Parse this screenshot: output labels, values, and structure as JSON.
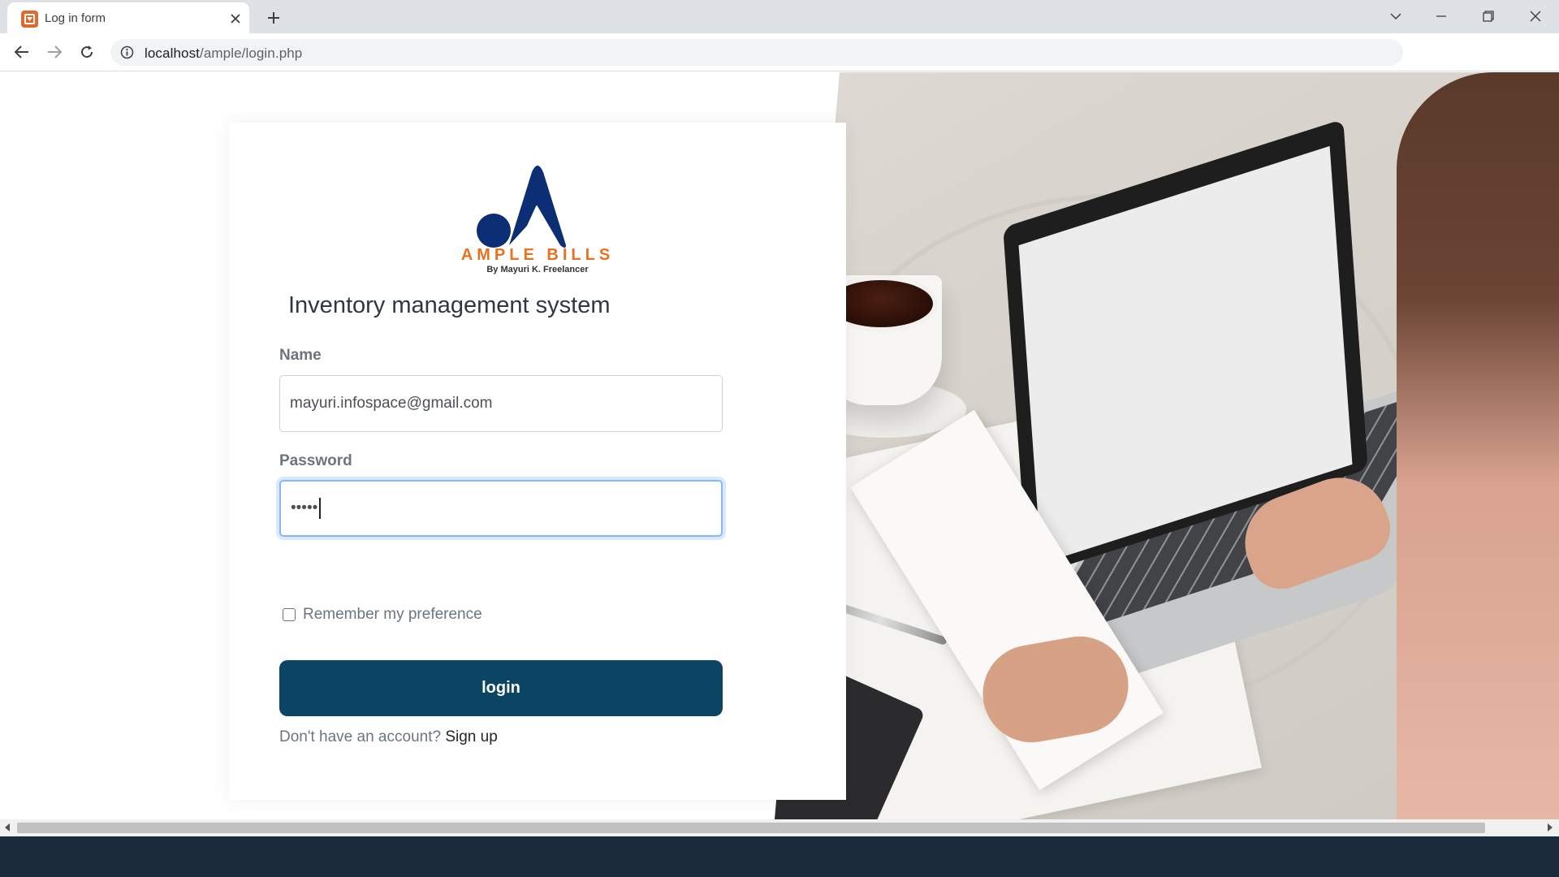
{
  "browser": {
    "tab_title": "Log in form",
    "url_host": "localhost",
    "url_path": "/ample/login.php"
  },
  "logo": {
    "name": "AMPLE BILLS",
    "tagline": "By Mayuri K. Freelancer",
    "mark_color": "#0b2e74",
    "name_color": "#e8731e"
  },
  "form": {
    "title": "Inventory management system",
    "name_label": "Name",
    "name_value": "mayuri.infospace@gmail.com",
    "password_label": "Password",
    "password_value": "•••••",
    "remember_label": "Remember my preference",
    "remember_checked": false,
    "login_label": "login",
    "signup_prompt": "Don't have an account?",
    "signup_link": "Sign up"
  },
  "colors": {
    "button": "#0b4563",
    "focus_ring": "#86b7fe",
    "taskbar": "#1c2b3c"
  },
  "icons": [
    "favicon-icon",
    "close-icon",
    "plus-icon",
    "chevron-down-icon",
    "minimize-icon",
    "restore-icon",
    "window-close-icon",
    "back-arrow-icon",
    "forward-arrow-icon",
    "reload-icon",
    "info-icon"
  ]
}
